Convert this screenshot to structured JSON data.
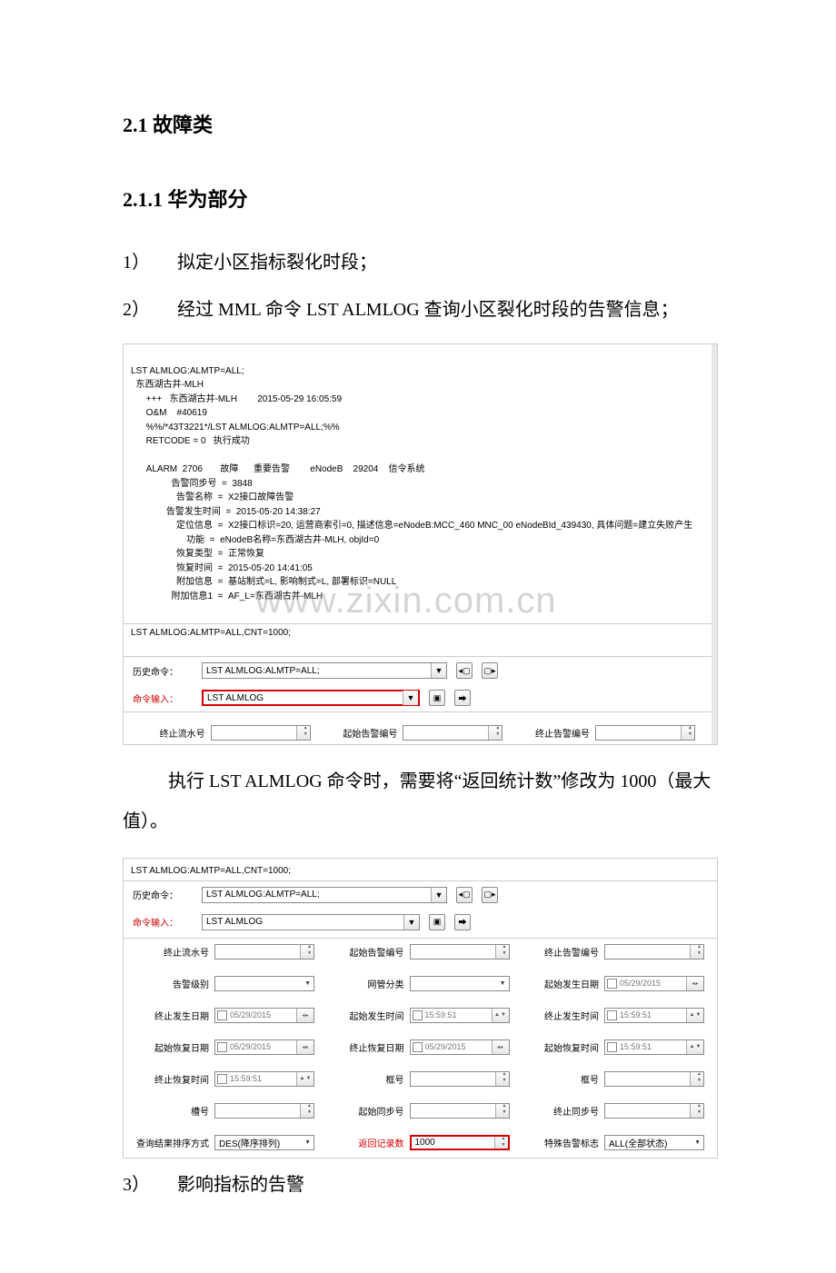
{
  "headings": {
    "h2": "2.1 故障类",
    "h3": "2.1.1 华为部分"
  },
  "steps": {
    "s1_num": "1）",
    "s1_text": "拟定小区指标裂化时段；",
    "s2_num": "2）",
    "s2_text": "经过 MML 命令 LST ALMLOG 查询小区裂化时段的告警信息；",
    "s3_num": "3）",
    "s3_text": "影响指标的告警"
  },
  "body1": "执行 LST ALMLOG 命令时，需要将“返回统计数”修改为 1000（最大值）。",
  "console": {
    "l0": "LST ALMLOG:ALMTP=ALL;",
    "l1": "  东西湖古井-MLH",
    "l2": "      +++   东西湖古井-MLH        2015-05-29 16:05:59",
    "l3": "      O&M    #40619",
    "l4": "      %%/*43T3221*/LST ALMLOG:ALMTP=ALL;%%",
    "l5": "      RETCODE = 0   执行成功",
    "blank1": " ",
    "l6": "      ALARM  2706       故障      重要告警        eNodeB    29204    信令系统",
    "l7": "                告警同步号  =  3848",
    "l8": "                  告警名称  =  X2接口故障告警",
    "l9": "              告警发生时间  =  2015-05-20 14:38:27",
    "l10": "                  定位信息  =  X2接口标识=20, 运营商索引=0, 描述信息=eNodeB:MCC_460 MNC_00 eNodeBId_439430, 具体问题=建立失败产生",
    "l11": "                      功能  =  eNodeB名称=东西湖古井-MLH, objId=0",
    "l12": "                  恢复类型  =  正常恢复",
    "l13": "                  恢复时间  =  2015-05-20 14:41:05",
    "l14": "                  附加信息  =  基站制式=L, 影响制式=L, 部署标识=NULL",
    "l15": "                附加信息1  =  AF_L=东西湖古井-MLH",
    "l16": "LST ALMLOG:ALMTP=ALL,CNT=1000;"
  },
  "cmd": {
    "history_label": "历史命令：",
    "history_value": "LST ALMLOG:ALMTP=ALL;",
    "input_label": "命令输入：",
    "input_value": "LST ALMLOG"
  },
  "params": {
    "end_seq": "终止流水号",
    "start_alarm": "起始告警编号",
    "end_alarm": "终止告警编号",
    "alarm_level": "告警级别",
    "nm_class": "网管分类",
    "start_date": "起始发生日期",
    "end_date": "终止发生日期",
    "start_time": "起始发生时间",
    "end_time": "终止发生时间",
    "start_recover_date": "起始恢复日期",
    "end_recover_date": "终止恢复日期",
    "start_recover_time": "起始恢复时间",
    "end_recover_time": "终止恢复时间",
    "frame": "框号",
    "frame2": "框号",
    "slot": "槽号",
    "start_sync": "起始同步号",
    "end_sync": "终止同步号",
    "sort": "查询结果排序方式",
    "sort_val": "DES(降序排列)",
    "return_count": "返回记录数",
    "return_count_val": "1000",
    "special": "特殊告警标志",
    "special_val": "ALL(全部状态)",
    "date_val": "05/29/2015",
    "time_val": "15:59:51"
  },
  "wm1": "www.zixin.com.cn",
  "panel2_top": "LST ALMLOG:ALMTP=ALL,CNT=1000;"
}
